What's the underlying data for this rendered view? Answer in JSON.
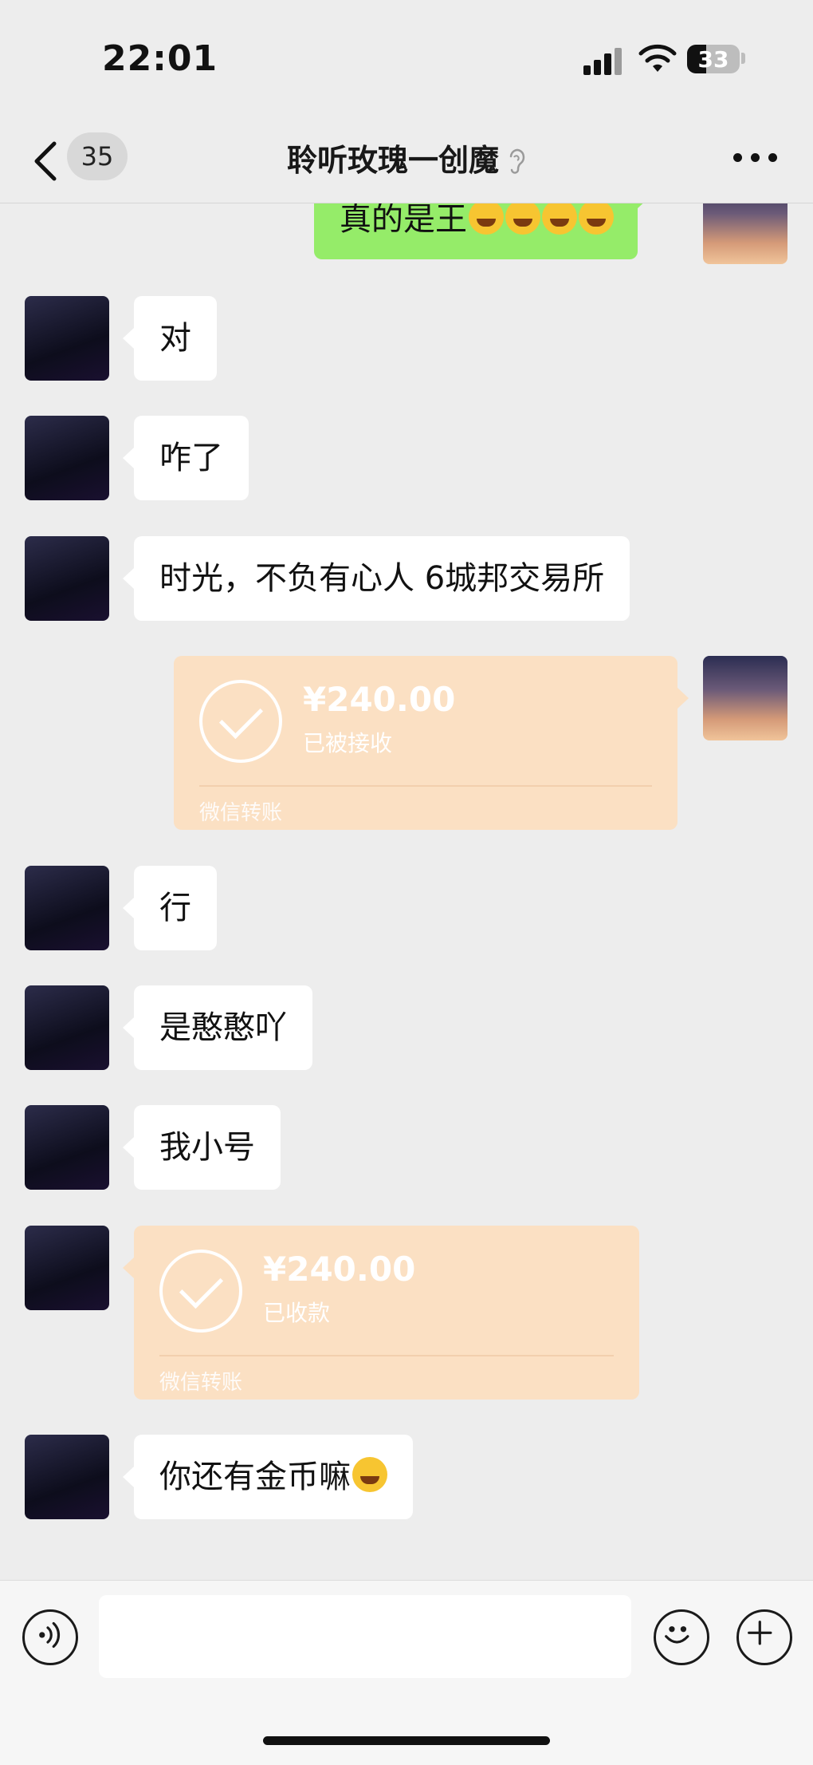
{
  "status_bar": {
    "time": "22:01",
    "battery": "33"
  },
  "nav": {
    "unread_count": "35",
    "title": "聆听玫瑰一创魔"
  },
  "messages": {
    "m0": "真的是王",
    "m1": "对",
    "m2": "咋了",
    "m3": "时光，不负有心人 6城邦交易所",
    "t1": {
      "amount": "¥240.00",
      "status": "已被接收",
      "brand": "微信转账"
    },
    "m4": "行",
    "m5": "是憨憨吖",
    "m6": "我小号",
    "t2": {
      "amount": "¥240.00",
      "status": "已收款",
      "brand": "微信转账"
    },
    "m7": "你还有金币嘛"
  },
  "icons": {
    "back": "chevron-left-icon",
    "ear": "ear-icon",
    "more": "more-icon",
    "voice": "voice-icon",
    "emoji": "emoji-icon",
    "plus": "plus-icon"
  },
  "colors": {
    "self_bubble": "#95ec69",
    "transfer_card": "#fbe0c3",
    "background": "#ededed"
  }
}
